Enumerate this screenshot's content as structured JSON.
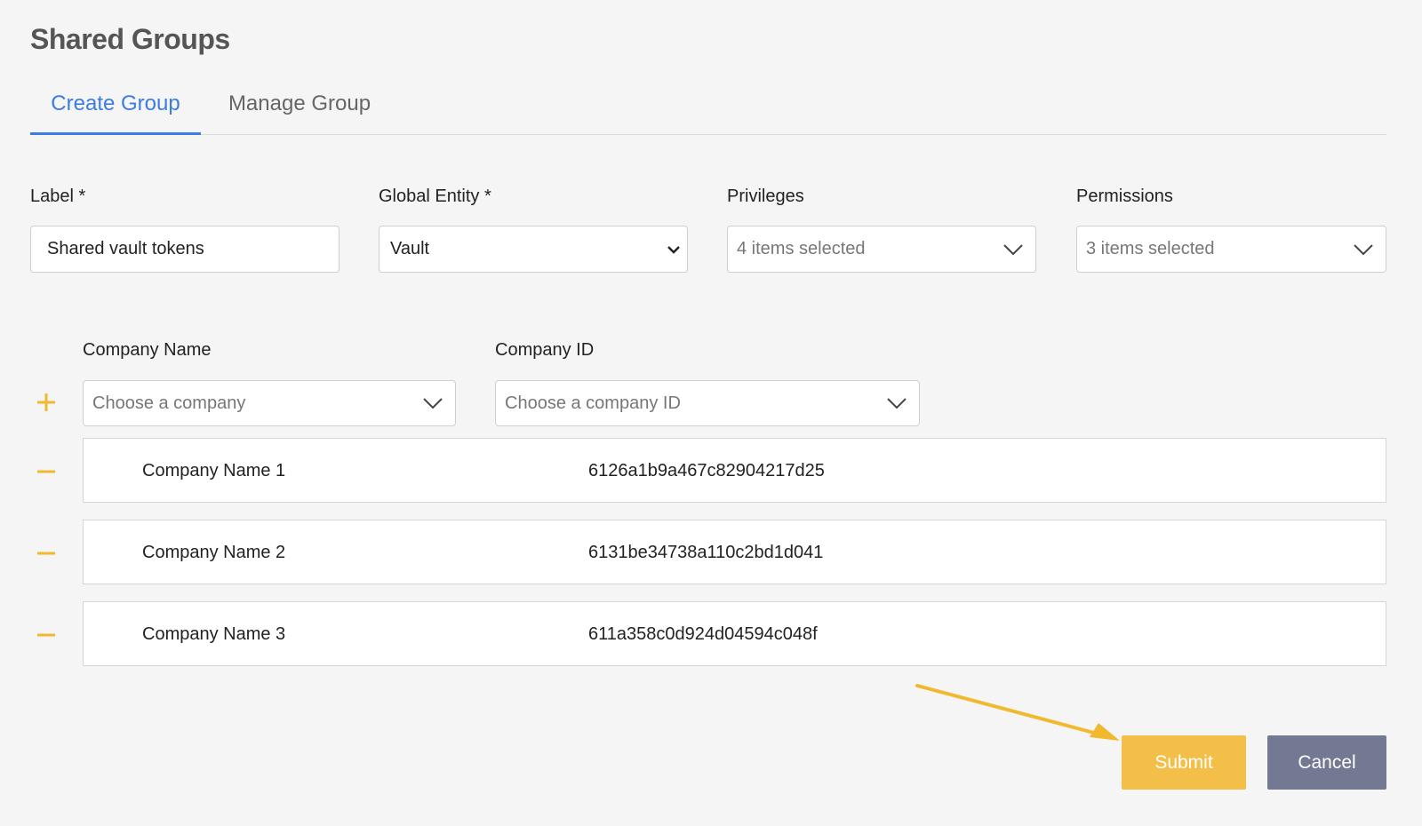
{
  "page": {
    "title": "Shared Groups"
  },
  "tabs": [
    {
      "label": "Create Group",
      "active": true
    },
    {
      "label": "Manage Group",
      "active": false
    }
  ],
  "form": {
    "label": {
      "label": "Label *",
      "value": "Shared vault tokens"
    },
    "global_entity": {
      "label": "Global Entity *",
      "value": "Vault"
    },
    "privileges": {
      "label": "Privileges",
      "value": "4 items selected"
    },
    "permissions": {
      "label": "Permissions",
      "value": "3 items selected"
    }
  },
  "companies": {
    "name_label": "Company Name",
    "id_label": "Company ID",
    "name_placeholder": "Choose a company",
    "id_placeholder": "Choose a company ID",
    "rows": [
      {
        "name": "Company Name 1",
        "id": "6126a1b9a467c82904217d25"
      },
      {
        "name": "Company Name 2",
        "id": "6131be34738a110c2bd1d041"
      },
      {
        "name": "Company Name 3",
        "id": "611a358c0d924d04594c048f"
      }
    ]
  },
  "actions": {
    "submit": "Submit",
    "cancel": "Cancel"
  },
  "colors": {
    "accent": "#3b7de0",
    "action_yellow": "#f3bf48",
    "cancel_gray": "#737993",
    "sign_yellow": "#f0b92e"
  }
}
